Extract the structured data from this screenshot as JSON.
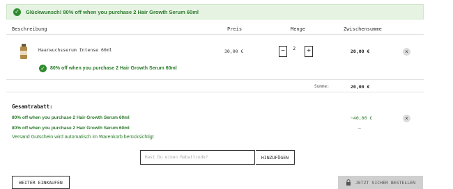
{
  "banner": {
    "text": "Glückwunsch! 80% off when you purchase 2 Hair Growth Serum 60ml"
  },
  "table": {
    "headers": {
      "description": "Beschreibung",
      "price": "Preis",
      "quantity": "Menge",
      "subtotal": "Zwischensumme"
    }
  },
  "item": {
    "name": "Haarwuchsserum Intense 60ml",
    "price": "30,00 €",
    "quantity": "2",
    "minus": "−",
    "plus": "+",
    "subtotal": "20,00 €",
    "remove": "×",
    "promo": "80% off when you purchase 2 Hair Growth Serum 60ml"
  },
  "summary": {
    "label": "Summe:",
    "value": "20,00 €"
  },
  "discounts": {
    "title": "Gesamtrabatt:",
    "line1": "80% off when you purchase 2 Hair Growth Serum 60ml",
    "line1_value": "−40,00 €",
    "line1_remove": "×",
    "line2": "80% off when you purchase 2 Hair Growth Serum 60ml",
    "line2_value": "–",
    "shipping_note": "Versand Gutschein wird automatisch im Warenkorb berücksichtigt"
  },
  "coupon": {
    "placeholder": "Hast Du einen Rabattcode?",
    "button": "HINZUFÜGEN"
  },
  "actions": {
    "continue": "WEITER EINKAUFEN",
    "checkout": "JETZT SICHER BESTELLEN"
  }
}
